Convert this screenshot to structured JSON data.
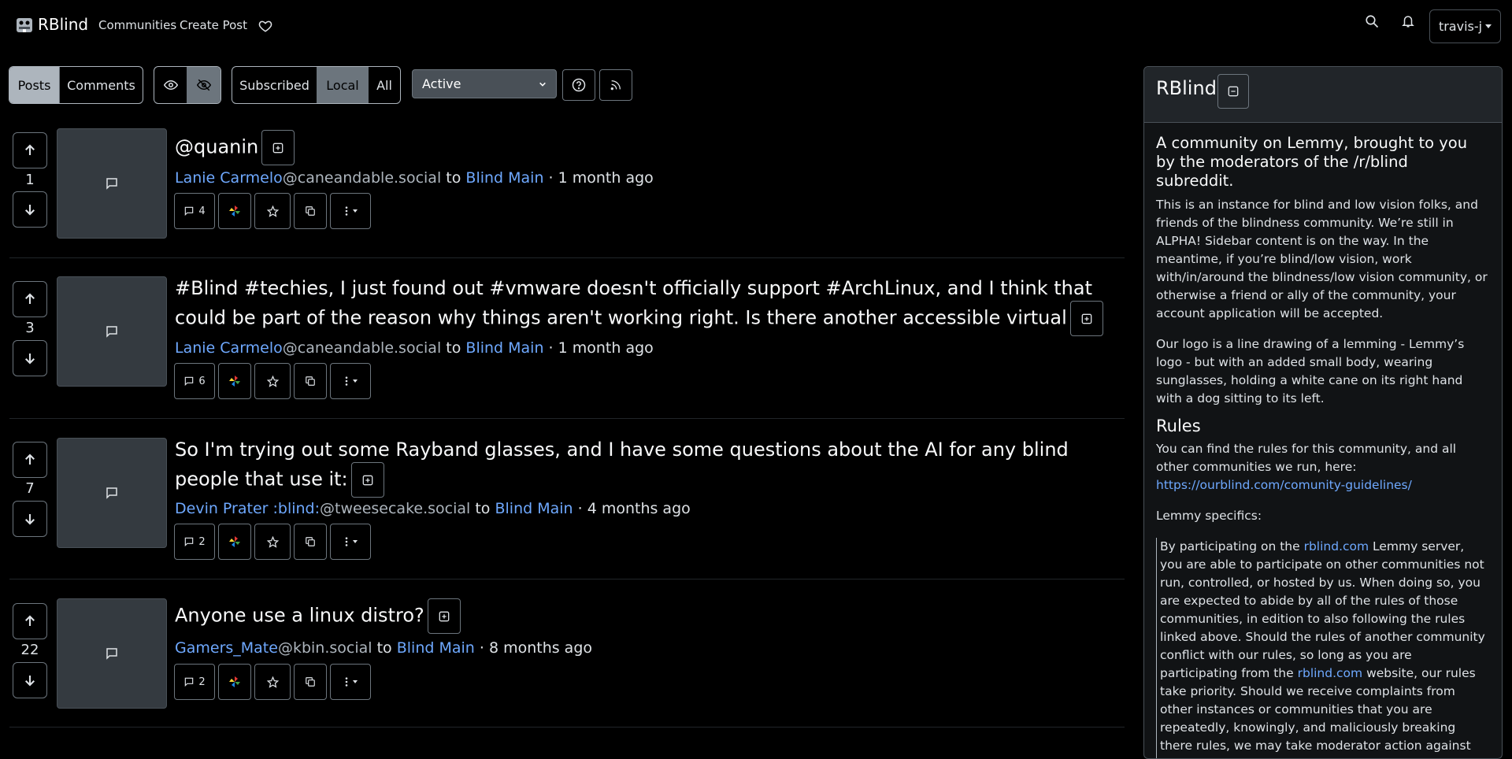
{
  "navbar": {
    "brand": "RBlind",
    "links": [
      "Communities",
      "Create Post"
    ],
    "user": "travis-j"
  },
  "toolbar": {
    "view_types": [
      "Posts",
      "Comments"
    ],
    "listing_types": [
      "Subscribed",
      "Local",
      "All"
    ],
    "sort": "Active"
  },
  "posts": [
    {
      "score": "1",
      "title": "@quanin",
      "author": "Lanie Carmelo",
      "instance": "@caneandable.social",
      "to": "to",
      "community": "Blind Main",
      "time": "· 1 month ago",
      "comments": "4"
    },
    {
      "score": "3",
      "title": "#Blind #techies, I just found out #vmware doesn't officially support #ArchLinux, and I think that could be part of the reason why things aren't working right. Is there another accessible virtual",
      "author": "Lanie Carmelo",
      "instance": "@caneandable.social",
      "to": "to",
      "community": "Blind Main",
      "time": "· 1 month ago",
      "comments": "6"
    },
    {
      "score": "7",
      "title": "So I'm trying out some Rayband glasses, and I have some questions about the AI for any blind people that use it:",
      "author": "Devin Prater :blind:",
      "instance": "@tweesecake.social",
      "to": "to",
      "community": "Blind Main",
      "time": "· 4 months ago",
      "comments": "2"
    },
    {
      "score": "22",
      "title": "Anyone use a linux distro?",
      "author": "Gamers_Mate",
      "instance": "@kbin.social",
      "to": "to",
      "community": "Blind Main",
      "time": "· 8 months ago",
      "comments": "2"
    }
  ],
  "sidebar": {
    "title": "RBlind",
    "lead": "A community on Lemmy, brought to you by the moderators of the /r/blind subreddit.",
    "p1": "This is an instance for blind and low vision folks, and friends of the blindness community. We’re still in ALPHA! Sidebar content is on the way. In the meantime, if you’re blind/low vision, work with/in/around the blindness/low vision community, or otherwise a friend or ally of the community, your account application will be accepted.",
    "p2": "Our logo is a line drawing of a lemming - Lemmy’s logo - but with an added small body, wearing sunglasses, holding a white cane on its right hand with a dog sitting to its left.",
    "rules_heading": "Rules",
    "rules_text": "You can find the rules for this community, and all other communities we run, here: ",
    "rules_link": "https://ourblind.com/comunity-guidelines/",
    "specifics": "Lemmy specifics:",
    "quote_a": "By participating on the ",
    "quote_link1": "rblind.com",
    "quote_b": " Lemmy server, you are able to participate on other communities not run, controlled, or hosted by us. When doing so, you are expected to abide by all of the rules of those communities, in edition to also following the rules linked above. Should the rules of another community conflict with our rules, so long as you are participating from the ",
    "quote_link2": "rblind.com",
    "quote_c": " website, our rules take priority. Should we receive complaints from other instances or communities that you are repeatedly, knowingly, and maliciously breaking there rules, we may take moderator action against you even if you are transparent with all of the"
  }
}
